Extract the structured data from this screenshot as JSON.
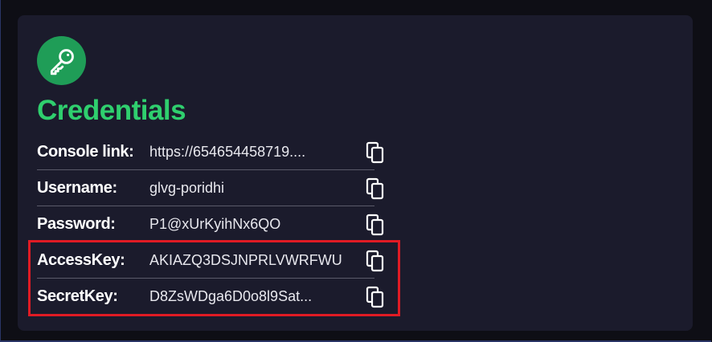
{
  "credentials": {
    "title": "Credentials",
    "icon": "key-icon",
    "rows": [
      {
        "label": "Console link:",
        "value": "https://654654458719...."
      },
      {
        "label": "Username:",
        "value": "glvg-poridhi"
      },
      {
        "label": "Password:",
        "value": "P1@xUrKyihNx6QO"
      },
      {
        "label": "AccessKey:",
        "value": "AKIAZQ3DSJNPRLVWRFWU"
      },
      {
        "label": "SecretKey:",
        "value": "D8ZsWDga6D0o8l9Sat..."
      }
    ]
  },
  "colors": {
    "accent_green": "#2fcf6e",
    "badge_green": "#1f9d57",
    "card_bg": "#1b1b2c",
    "highlight_red": "#e01b24"
  }
}
